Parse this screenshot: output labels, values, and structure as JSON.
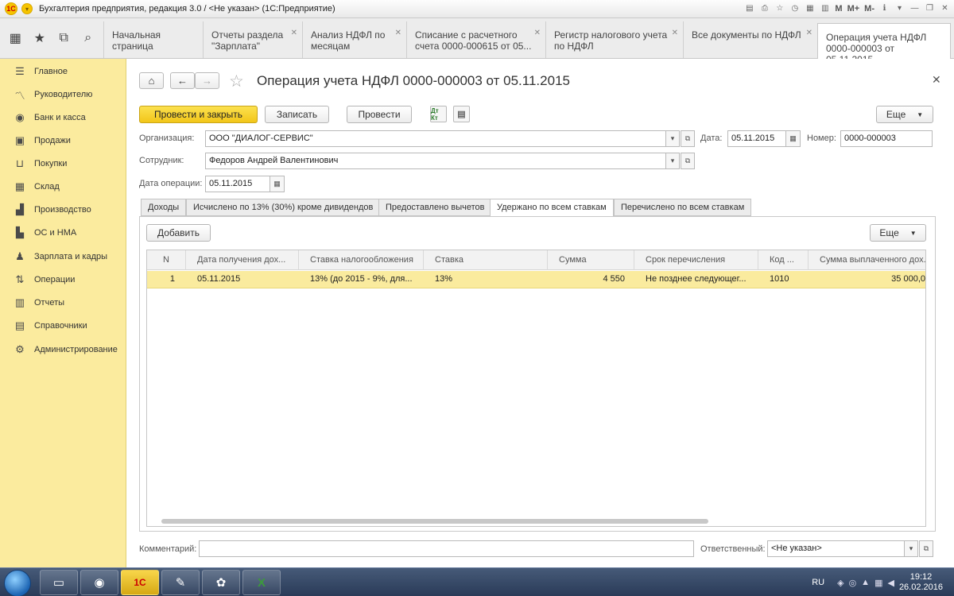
{
  "titlebar": {
    "logo": "1С",
    "title": "Бухгалтерия предприятия, редакция 3.0 / <Не указан>  (1С:Предприятие)",
    "icons": [
      "M",
      "M+",
      "M-"
    ]
  },
  "open_tabs": [
    {
      "label": "Начальная страница"
    },
    {
      "label": "Отчеты раздела \"Зарплата\""
    },
    {
      "label": "Анализ НДФЛ по месяцам"
    },
    {
      "label": "Списание с расчетного счета 0000-000615 от 05..."
    },
    {
      "label": "Регистр налогового учета по НДФЛ"
    },
    {
      "label": "Все документы по НДФЛ"
    },
    {
      "label": "Операция учета НДФЛ 0000-000003 от 05.11.2015"
    }
  ],
  "sidebar": {
    "items": [
      {
        "label": "Главное",
        "icon": "menu-icon"
      },
      {
        "label": "Руководителю",
        "icon": "chart-line-icon"
      },
      {
        "label": "Банк и касса",
        "icon": "coin-icon"
      },
      {
        "label": "Продажи",
        "icon": "bag-icon"
      },
      {
        "label": "Покупки",
        "icon": "cart-icon"
      },
      {
        "label": "Склад",
        "icon": "warehouse-icon"
      },
      {
        "label": "Производство",
        "icon": "factory-icon"
      },
      {
        "label": "ОС и НМА",
        "icon": "building-icon"
      },
      {
        "label": "Зарплата и кадры",
        "icon": "person-icon"
      },
      {
        "label": "Операции",
        "icon": "operations-icon"
      },
      {
        "label": "Отчеты",
        "icon": "bar-chart-icon"
      },
      {
        "label": "Справочники",
        "icon": "book-icon"
      },
      {
        "label": "Администрирование",
        "icon": "gear-icon"
      }
    ]
  },
  "document": {
    "title": "Операция учета НДФЛ 0000-000003 от 05.11.2015",
    "buttons": {
      "post_close": "Провести и закрыть",
      "save": "Записать",
      "post": "Провести",
      "more": "Еще"
    },
    "icon_btn_label": "Дт Кт",
    "fields": {
      "org_label": "Организация:",
      "org_value": "ООО \"ДИАЛОГ-СЕРВИС\"",
      "date_label": "Дата:",
      "date_value": "05.11.2015",
      "number_label": "Номер:",
      "number_value": "0000-000003",
      "employee_label": "Сотрудник:",
      "employee_value": "Федоров Андрей Валентинович",
      "op_date_label": "Дата операции:",
      "op_date_value": "05.11.2015"
    },
    "page_tabs": [
      {
        "label": "Доходы"
      },
      {
        "label": "Исчислено по 13% (30%) кроме дивидендов"
      },
      {
        "label": "Предоставлено вычетов"
      },
      {
        "label": "Удержано по всем ставкам"
      },
      {
        "label": "Перечислено по всем ставкам"
      }
    ],
    "table_buttons": {
      "add": "Добавить",
      "more": "Еще"
    },
    "table": {
      "columns": [
        "N",
        "Дата получения дох...",
        "Ставка налогообложения",
        "Ставка",
        "Сумма",
        "Срок перечисления",
        "Код ...",
        "Сумма выплаченного дох..."
      ],
      "rows": [
        [
          "1",
          "05.11.2015",
          "13% (до 2015 - 9%, для...",
          "13%",
          "4 550",
          "Не позднее следующег...",
          "1010",
          "35 000,0"
        ]
      ]
    },
    "footer": {
      "comment_label": "Комментарий:",
      "comment_value": "",
      "responsible_label": "Ответственный:",
      "responsible_value": "<Не указан>"
    }
  },
  "taskbar": {
    "lang": "RU",
    "time": "19:12",
    "date": "26.02.2016"
  }
}
